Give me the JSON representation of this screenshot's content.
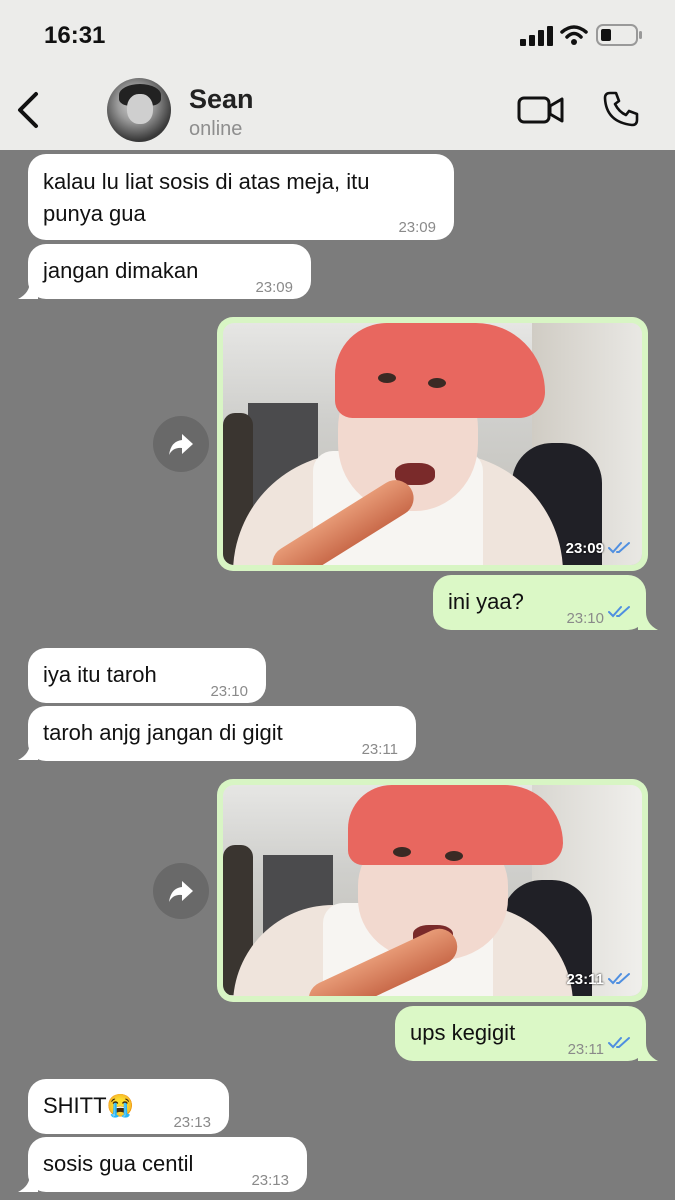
{
  "status_bar": {
    "time": "16:31"
  },
  "header": {
    "contact_name": "Sean",
    "contact_status": "online"
  },
  "messages": [
    {
      "text_line1": "kalau lu liat sosis di atas meja, itu",
      "text_line2": "punya gua",
      "time": "23:09"
    },
    {
      "text": "jangan dimakan",
      "time": "23:09"
    },
    {
      "time": "23:09"
    },
    {
      "text": "ini yaa?",
      "time": "23:10"
    },
    {
      "text": "iya itu taroh",
      "time": "23:10"
    },
    {
      "text": "taroh anjg jangan di gigit",
      "time": "23:11"
    },
    {
      "time": "23:11"
    },
    {
      "text": "ups kegigit",
      "time": "23:11"
    },
    {
      "text": "SHITT😭",
      "time": "23:13"
    },
    {
      "text": "sosis gua centil",
      "time": "23:13"
    }
  ],
  "colors": {
    "incoming": "#ffffff",
    "outgoing": "#dbf8c6",
    "background": "#7c7c7c",
    "read_tick": "#4f8fe0"
  },
  "icons": {
    "back": "chevron-left-icon",
    "video": "video-camera-icon",
    "call": "phone-icon",
    "forward": "forward-arrow-icon",
    "read": "double-check-icon"
  }
}
